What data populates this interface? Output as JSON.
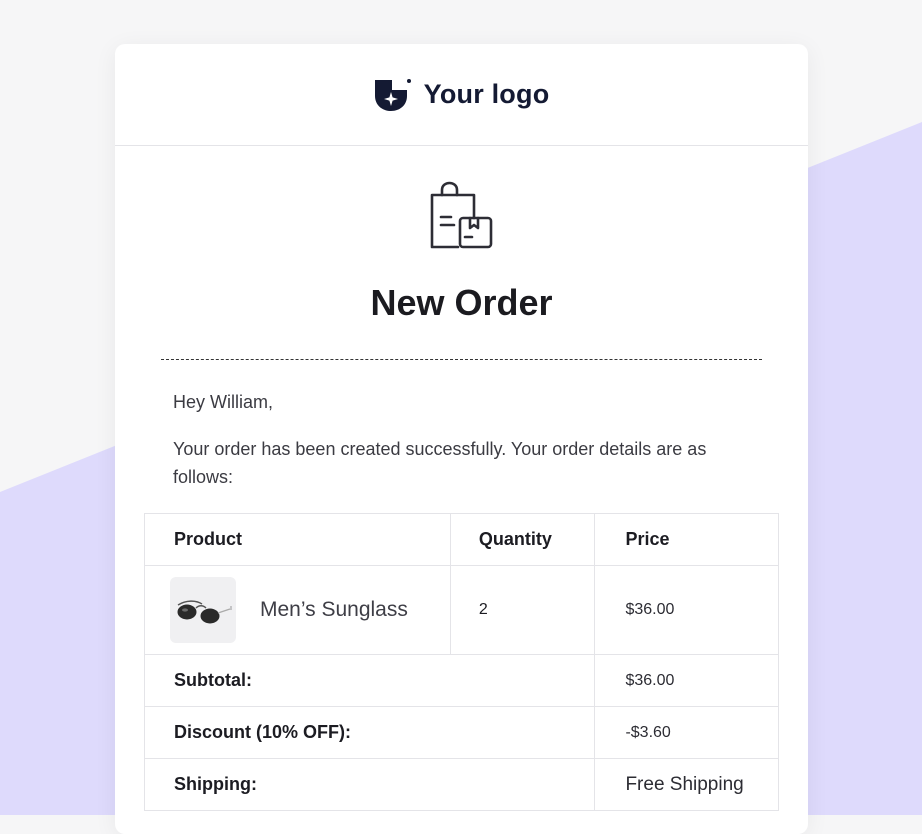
{
  "brand": {
    "logo_text": "Your logo",
    "logo_icon": "shield-star-icon",
    "color": "#141a33"
  },
  "colors": {
    "background": "#f6f6f7",
    "accent_shape": "#dedafc",
    "card": "#ffffff",
    "border": "#e4e4e8"
  },
  "hero": {
    "icon": "shopping-bag-with-box-icon",
    "title": "New Order"
  },
  "message": {
    "greeting": "Hey William,",
    "body": "Your order has been created successfully. Your order details are as follows:"
  },
  "table": {
    "headers": {
      "product": "Product",
      "quantity": "Quantity",
      "price": "Price"
    },
    "items": [
      {
        "name": "Men’s Sunglass",
        "image_icon": "sunglasses-icon",
        "quantity": "2",
        "price": "$36.00"
      }
    ],
    "summary": [
      {
        "label": "Subtotal:",
        "value": "$36.00"
      },
      {
        "label": "Discount (10% OFF):",
        "value": "-$3.60"
      },
      {
        "label": "Shipping:",
        "value": "Free Shipping"
      }
    ]
  }
}
